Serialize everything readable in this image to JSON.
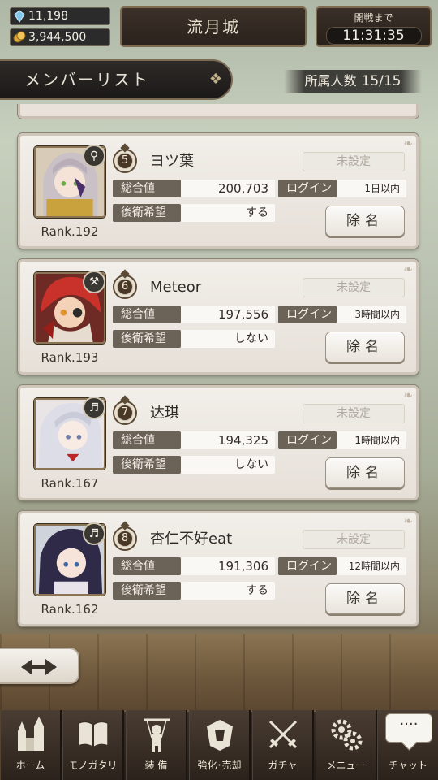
{
  "resources": {
    "crystal": "11,198",
    "gold": "3,944,500"
  },
  "castle": "流月城",
  "battle": {
    "label": "開戦まで",
    "time": "11:31:35"
  },
  "list_header": {
    "title": "メンバーリスト",
    "count_label": "所属人数",
    "count_value": "15/15"
  },
  "labels": {
    "total": "総合値",
    "login": "ログイン",
    "rear": "後衛希望",
    "remove": "除名"
  },
  "members": [
    {
      "order": "5",
      "name": "ヨツ葉",
      "status": "未設定",
      "total": "200,703",
      "login": "1日以内",
      "rear": "する",
      "rank": "Rank.192",
      "role_icon": "magnifier-icon"
    },
    {
      "order": "6",
      "name": "Meteor",
      "status": "未設定",
      "total": "197,556",
      "login": "3時間以内",
      "rear": "しない",
      "rank": "Rank.193",
      "role_icon": "hammer-icon"
    },
    {
      "order": "7",
      "name": "达琪",
      "status": "未設定",
      "total": "194,325",
      "login": "1時間以内",
      "rear": "しない",
      "rank": "Rank.167",
      "role_icon": "harp-icon"
    },
    {
      "order": "8",
      "name": "杏仁不好eat",
      "status": "未設定",
      "total": "191,306",
      "login": "12時間以内",
      "rear": "する",
      "rank": "Rank.162",
      "role_icon": "harp-icon"
    }
  ],
  "nav": {
    "home": "ホーム",
    "story": "モノガタリ",
    "equip": "装 備",
    "enhance": "強化･売却",
    "gacha": "ガチャ",
    "menu": "メニュー",
    "chat": "チャット",
    "chat_dots": "····"
  },
  "colors": {
    "card_bg": "#f2eee9",
    "label_bg": "#6c6358",
    "nav_bg": "#3b3029",
    "header_bg": "#2e2a27"
  }
}
